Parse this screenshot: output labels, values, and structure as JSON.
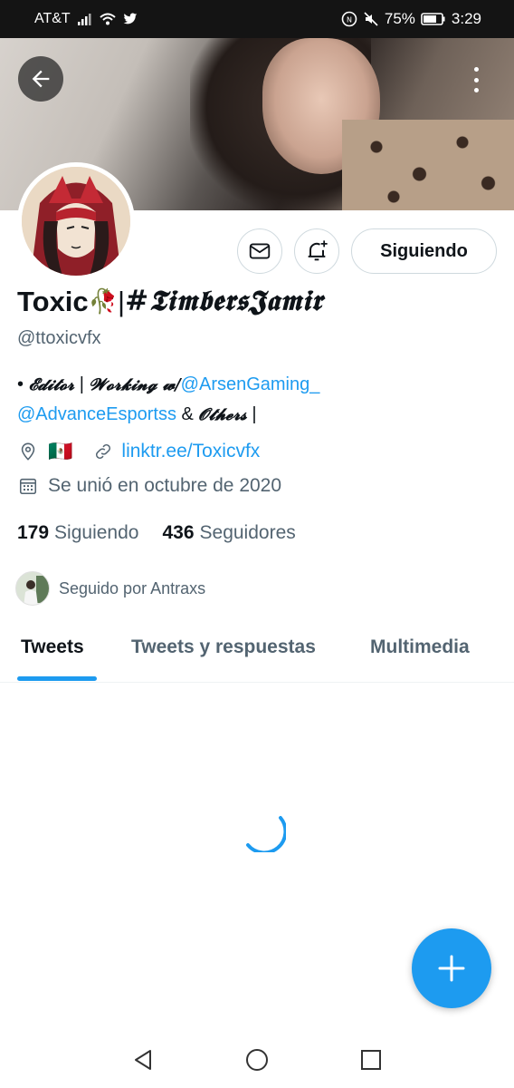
{
  "status_bar": {
    "carrier": "AT&T",
    "battery": "75%",
    "time": "3:29"
  },
  "header": {
    "back_icon": "arrow-left-icon",
    "more_icon": "more-vertical-icon"
  },
  "profile": {
    "name": "Toxic",
    "name_emoji": "🥀",
    "name_separator": " | ",
    "name_suffix": "#𝕿𝖎𝖒𝖇𝖊𝖗𝖘𝕵𝖆𝖒𝖎𝖗",
    "handle": "@ttoxicvfx",
    "bio": {
      "prefix": "• ",
      "editor": "𝓔𝓭𝓲𝓽𝓸𝓻",
      "sep1": " | ",
      "working": "𝓦𝓸𝓻𝓴𝓲𝓷𝓰 𝔀/",
      "mention1": "@ArsenGaming_",
      "mention2": "@AdvanceEsportss",
      "amp": " & ",
      "others": "𝓞𝓽𝓱𝓮𝓻𝓼",
      "end": " |"
    },
    "location_flag": "🇲🇽",
    "url": "linktr.ee/Toxicvfx",
    "joined": "Se unió en octubre de 2020",
    "following_count": "179",
    "following_label": "Siguiendo",
    "followers_count": "436",
    "followers_label": "Seguidores",
    "followed_by": "Seguido por Antraxs"
  },
  "actions": {
    "message_icon": "envelope-icon",
    "notify_icon": "bell-plus-icon",
    "follow_label": "Siguiendo"
  },
  "tabs": [
    {
      "label": "Tweets",
      "active": true
    },
    {
      "label": "Tweets y respuestas",
      "active": false
    },
    {
      "label": "Multimedia",
      "active": false
    }
  ],
  "colors": {
    "accent": "#1d9bf0",
    "text_primary": "#0f1419",
    "text_secondary": "#536471"
  },
  "fab": {
    "icon": "plus-icon"
  },
  "nav": {
    "back": "triangle-back-icon",
    "home": "circle-home-icon",
    "recents": "square-recents-icon"
  }
}
